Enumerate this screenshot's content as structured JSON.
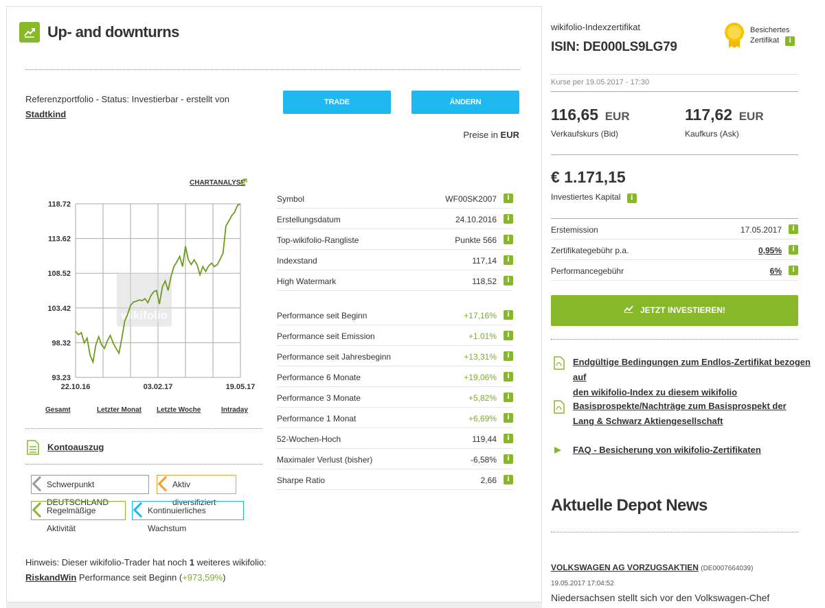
{
  "left": {
    "title": "Up- and downturns",
    "ref_text": "Referenzportfolio - Status: Investierbar - erstellt von",
    "ref_author": "Stadtkind",
    "trade_label": "TRADE",
    "edit_label": "ÄNDERN",
    "prices_label": "Preise in",
    "prices_currency": "EUR",
    "chartanalyse_label": "CHARTANALYSE",
    "chart_tabs": [
      "Gesamt",
      "Letzter Monat",
      "Letzte Woche",
      "Intraday"
    ],
    "konto_label": "Kontoauszug",
    "tags": [
      {
        "label": "Schwerpunkt DEUTSCHLAND",
        "color": "#999999"
      },
      {
        "label": "Aktiv diversifiziert",
        "color": "#f0a030"
      },
      {
        "label": "Regelmäßige Aktivität",
        "color": "#86b82a"
      },
      {
        "label": "Kontinuierliches Wachstum",
        "color": "#1eb7ef"
      }
    ],
    "hint_text": "Hinweis: Dieser wikifolio-Trader hat noch",
    "hint_count": "1",
    "hint_text2": "weiteres wikifolio:",
    "hint_link": "RiskandWin",
    "hint_perf_label": "Performance seit Beginn (",
    "hint_perf_value": "+973,59%",
    "hint_close": ")"
  },
  "table1": [
    {
      "label": "Symbol",
      "value": "WF00SK2007"
    },
    {
      "label": "Erstellungsdatum",
      "value": "24.10.2016"
    },
    {
      "label": "Top-wikifolio-Rangliste",
      "value": "Punkte 566"
    },
    {
      "label": "Indexstand",
      "value": "117,14"
    },
    {
      "label": "High Watermark",
      "value": "118,52"
    }
  ],
  "table2": [
    {
      "label": "Performance seit Beginn",
      "value": "+17,16%",
      "positive": true
    },
    {
      "label": "Performance seit Emission",
      "value": "+1.01%",
      "positive": true
    },
    {
      "label": "Performance seit Jahresbeginn",
      "value": "+13,31%",
      "positive": true
    },
    {
      "label": "Performance 6 Monate",
      "value": "+19,06%",
      "positive": true
    },
    {
      "label": "Performance 3 Monate",
      "value": "+5,82%",
      "positive": true
    },
    {
      "label": "Performance 1 Monat",
      "value": "+6,69%",
      "positive": true
    },
    {
      "label": "52-Wochen-Hoch",
      "value": "119,44",
      "positive": false
    },
    {
      "label": "Maximaler Verlust (bisher)",
      "value": "-6,58%",
      "positive": false
    },
    {
      "label": "Sharpe Ratio",
      "value": "2,66",
      "positive": false
    }
  ],
  "chart_data": {
    "type": "line",
    "ylim": [
      93.23,
      118.72
    ],
    "y_ticks": [
      "118.72",
      "113.62",
      "108.52",
      "103.42",
      "98.32",
      "93.23"
    ],
    "x_ticks": [
      "22.10.16",
      "03.02.17",
      "19.05.17"
    ],
    "watermark": "wikifolio",
    "series": [
      {
        "color": "#6e9a1e",
        "values": [
          100.0,
          99.5,
          99.8,
          98.3,
          99.0,
          96.5,
          95.5,
          98.0,
          99.2,
          98.0,
          97.5,
          98.6,
          99.4,
          98.3,
          97.5,
          96.8,
          99.0,
          101.5,
          102.5,
          103.8,
          104.3,
          104.4,
          104.6,
          104.5,
          104.8,
          104.2,
          105.2,
          105.8,
          106.0,
          104.0,
          106.5,
          107.4,
          106.0,
          108.0,
          109.5,
          110.2,
          111.0,
          109.5,
          112.5,
          110.5,
          109.8,
          110.5,
          109.8,
          108.3,
          109.5,
          108.8,
          109.6,
          110.0,
          109.5,
          109.8,
          110.6,
          111.5,
          115.5,
          116.2,
          117.0,
          117.5,
          118.5,
          118.72
        ]
      }
    ]
  },
  "right": {
    "cert_type": "wikifolio-Indexzertifikat",
    "isin": "ISIN: DE000LS9LG79",
    "badge_line1": "Besichertes",
    "badge_line2": "Zertifikat",
    "kurse_label": "Kurse per 19.05.2017 - 17:30",
    "bid_value": "116,65",
    "bid_currency": "EUR",
    "bid_label": "Verkaufskurs (Bid)",
    "ask_value": "117,62",
    "ask_currency": "EUR",
    "ask_label": "Kaufkurs (Ask)",
    "capital_value": "€ 1.171,15",
    "capital_label": "Investiertes Kapital",
    "rows": [
      {
        "label": "Erstemission",
        "value": "17.05.2017",
        "link": false
      },
      {
        "label": "Zertifikategebühr p.a.",
        "value": "0,95%",
        "link": true
      },
      {
        "label": "Performancegebühr",
        "value": "6%",
        "link": true
      }
    ],
    "invest_label": "JETZT INVESTIEREN!",
    "docs": [
      {
        "line1": "Endgültige Bedingungen zum Endlos-Zertifikat bezogen auf",
        "line2": "den wikifolio-Index zu diesem wikifolio"
      },
      {
        "line1": "Basisprospekte/Nachträge zum Basisprospekt der",
        "line2": "Lang & Schwarz Aktiengesellschaft"
      }
    ],
    "faq_label": "FAQ - Besicherung von wikifolio-Zertifikaten",
    "news_title": "Aktuelle Depot News",
    "news_company": "VOLKSWAGEN AG VORZUGSAKTIEN",
    "news_isin": "(DE0007664039)",
    "news_date": "19.05.2017 17:04:52",
    "news_headline": "Niedersachsen stellt sich vor den Volkswagen-Chef"
  }
}
